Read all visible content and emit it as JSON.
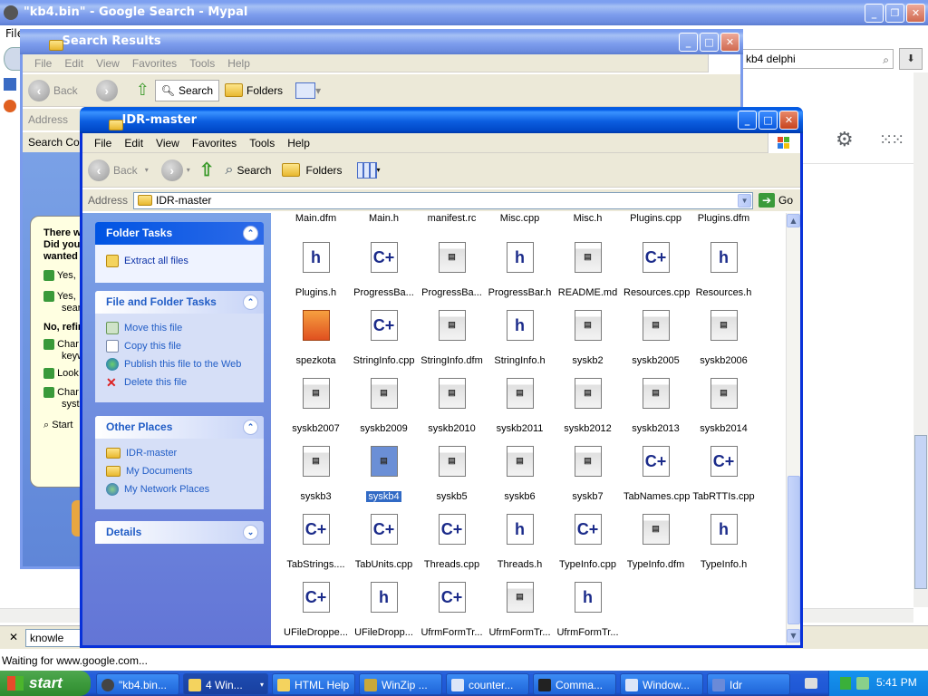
{
  "browser": {
    "title": "\"kb4.bin\" - Google Search - Mypal",
    "menu_first": "File",
    "search_box_value": "kb4 delphi",
    "find_value": "knowle",
    "status": "Waiting for www.google.com...",
    "balloon": [
      "There w",
      "Did you",
      "wanted",
      "Yes,",
      "Yes,",
      "sear",
      "No, refin",
      "Char",
      "keyw",
      "Look",
      "Char",
      "syste",
      "Start"
    ]
  },
  "search_results": {
    "title": "Search Results",
    "menu": [
      "File",
      "Edit",
      "View",
      "Favorites",
      "Tools",
      "Help"
    ],
    "toolbar": {
      "back": "Back",
      "search": "Search",
      "folders": "Folders"
    },
    "address_label": "Address",
    "search_companion": "Search Com"
  },
  "explorer": {
    "title": "IDR-master",
    "menu": [
      "File",
      "Edit",
      "View",
      "Favorites",
      "Tools",
      "Help"
    ],
    "toolbar": {
      "back": "Back",
      "search": "Search",
      "folders": "Folders"
    },
    "address_label": "Address",
    "address_value": "IDR-master",
    "go": "Go",
    "folder_tasks": {
      "header": "Folder Tasks",
      "items": [
        "Extract all files"
      ]
    },
    "file_tasks": {
      "header": "File and Folder Tasks",
      "items": [
        "Move this file",
        "Copy this file",
        "Publish this file to the Web",
        "Delete this file"
      ]
    },
    "other_places": {
      "header": "Other Places",
      "items": [
        "IDR-master",
        "My Documents",
        "My Network Places"
      ]
    },
    "details": {
      "header": "Details"
    },
    "top_row": [
      "Main.dfm",
      "Main.h",
      "manifest.rc",
      "Misc.cpp",
      "Misc.h",
      "Plugins.cpp",
      "Plugins.dfm"
    ],
    "files": [
      [
        {
          "n": "Plugins.h",
          "t": "h"
        },
        {
          "n": "ProgressBa...",
          "t": "cpp"
        },
        {
          "n": "ProgressBa...",
          "t": "dfm"
        },
        {
          "n": "ProgressBar.h",
          "t": "h"
        },
        {
          "n": "README.md",
          "t": "dfm"
        },
        {
          "n": "Resources.cpp",
          "t": "cpp"
        },
        {
          "n": "Resources.h",
          "t": "h"
        }
      ],
      [
        {
          "n": "spezkota",
          "t": "img"
        },
        {
          "n": "StringInfo.cpp",
          "t": "cpp"
        },
        {
          "n": "StringInfo.dfm",
          "t": "dfm"
        },
        {
          "n": "StringInfo.h",
          "t": "h"
        },
        {
          "n": "syskb2",
          "t": "dfm"
        },
        {
          "n": "syskb2005",
          "t": "dfm"
        },
        {
          "n": "syskb2006",
          "t": "dfm"
        }
      ],
      [
        {
          "n": "syskb2007",
          "t": "dfm"
        },
        {
          "n": "syskb2009",
          "t": "dfm"
        },
        {
          "n": "syskb2010",
          "t": "dfm"
        },
        {
          "n": "syskb2011",
          "t": "dfm"
        },
        {
          "n": "syskb2012",
          "t": "dfm"
        },
        {
          "n": "syskb2013",
          "t": "dfm"
        },
        {
          "n": "syskb2014",
          "t": "dfm"
        }
      ],
      [
        {
          "n": "syskb3",
          "t": "dfm"
        },
        {
          "n": "syskb4",
          "t": "dfm",
          "sel": true
        },
        {
          "n": "syskb5",
          "t": "dfm"
        },
        {
          "n": "syskb6",
          "t": "dfm"
        },
        {
          "n": "syskb7",
          "t": "dfm"
        },
        {
          "n": "TabNames.cpp",
          "t": "cpp"
        },
        {
          "n": "TabRTTIs.cpp",
          "t": "cpp"
        }
      ],
      [
        {
          "n": "TabStrings....",
          "t": "cpp"
        },
        {
          "n": "TabUnits.cpp",
          "t": "cpp"
        },
        {
          "n": "Threads.cpp",
          "t": "cpp"
        },
        {
          "n": "Threads.h",
          "t": "h"
        },
        {
          "n": "TypeInfo.cpp",
          "t": "cpp"
        },
        {
          "n": "TypeInfo.dfm",
          "t": "dfm"
        },
        {
          "n": "TypeInfo.h",
          "t": "h"
        }
      ],
      [
        {
          "n": "UFileDroppe...",
          "t": "cpp"
        },
        {
          "n": "UFileDropp...",
          "t": "h"
        },
        {
          "n": "UfrmFormTr...",
          "t": "cpp"
        },
        {
          "n": "UfrmFormTr...",
          "t": "dfm"
        },
        {
          "n": "UfrmFormTr...",
          "t": "h"
        }
      ]
    ]
  },
  "taskbar": {
    "start": "start",
    "tasks": [
      "\"kb4.bin...",
      "4 Win...",
      "HTML Help",
      "WinZip ...",
      "counter...",
      "Comma...",
      "Window...",
      "Idr"
    ],
    "clock": "5:41 PM"
  },
  "icon_glyphs": {
    "cpp": "C+",
    "h": "h",
    "dfm": "▤",
    "img": ""
  },
  "colors": {
    "xp_blue": "#0058e6",
    "taskbar": "#245edb",
    "start_green": "#3c9a3c",
    "selection": "#316ac5",
    "panel_header": "#215dc6"
  }
}
